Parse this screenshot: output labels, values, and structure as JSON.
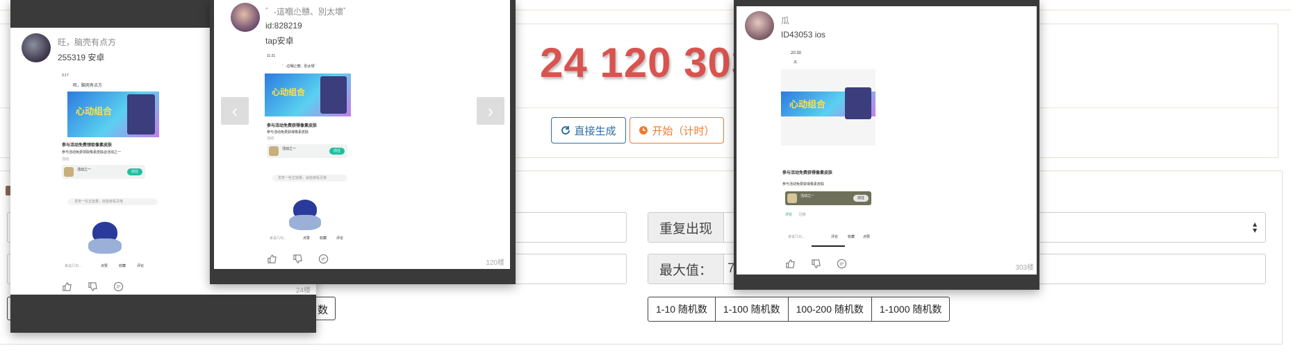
{
  "numbers_display": "24 120 303",
  "buttons": {
    "generate": "直接生成",
    "start": "开始（计时）"
  },
  "fields": {
    "repeat_label": "重复出现",
    "max_label": "最大值：",
    "max_value": "7",
    "left_button_tail": "数"
  },
  "ranges": [
    "1-10 随机数",
    "1-100 随机数",
    "100-200 随机数",
    "1-1000 随机数"
  ],
  "nav": {
    "prev": "‹",
    "next": "›"
  },
  "cards": [
    {
      "user": "旺，脑壳有点方",
      "id": "255319  安卓",
      "floor": "24楼",
      "shot": {
        "time": "3:17",
        "title_small": "旺，脑壳有点方",
        "banner": "心动组合",
        "heading": "参与活动免费领取像素皮肤",
        "sub": "参与活动免费领取像素皮肤@活动之一",
        "tag": "活动",
        "game": "活动之一",
        "join": "前往",
        "comment_ph": "发表一些正能量，就能被看见哦",
        "footer_ph": "来说几句...",
        "f1": "点赞",
        "f2": "收藏",
        "f3": "评论"
      }
    },
    {
      "user": "゛-這嗰尐戇、別太壞゛",
      "id": "id:828219",
      "platform": "tap安卓",
      "floor": "120楼",
      "shot": {
        "time": "11:21",
        "title_small": "゛-這嗰尐戇、別太壞゛",
        "banner": "心动组合",
        "heading": "参与活动免费获得像素皮肤",
        "sub": "参与活动免费获得像素皮肤",
        "tag": "活动",
        "game": "活动之一",
        "join": "前往",
        "comment_ph": "发表一些正能量，就能被看见哦",
        "footer_ph": "来说几句...",
        "f1": "点赞",
        "f2": "收藏",
        "f3": "评论"
      }
    },
    {
      "user": "瓜",
      "id": "ID43053 ios",
      "floor": "303楼",
      "shot": {
        "time": "20:30",
        "title_small": "瓜",
        "banner": "心动组合",
        "heading": "参与活动免费获得像素皮肤",
        "sub": "参与活动免费获得像素皮肤",
        "tag": "活动",
        "game": "活动之一",
        "join": "前往",
        "tab1": "评论",
        "tab2": "回复",
        "footer_ph": "来说几句...",
        "f1": "评论",
        "f2": "收藏",
        "f3": "点赞"
      }
    }
  ],
  "colors": {
    "accent_red": "#d9534f",
    "btn_blue": "#2e6da4",
    "btn_orange": "#ee7a2f",
    "card_bar": "#3a3a3a"
  },
  "icons": [
    "refresh-icon",
    "clock-icon",
    "thumb-up-icon",
    "thumb-down-icon",
    "comment-icon",
    "chevron-left-icon",
    "chevron-right-icon"
  ]
}
